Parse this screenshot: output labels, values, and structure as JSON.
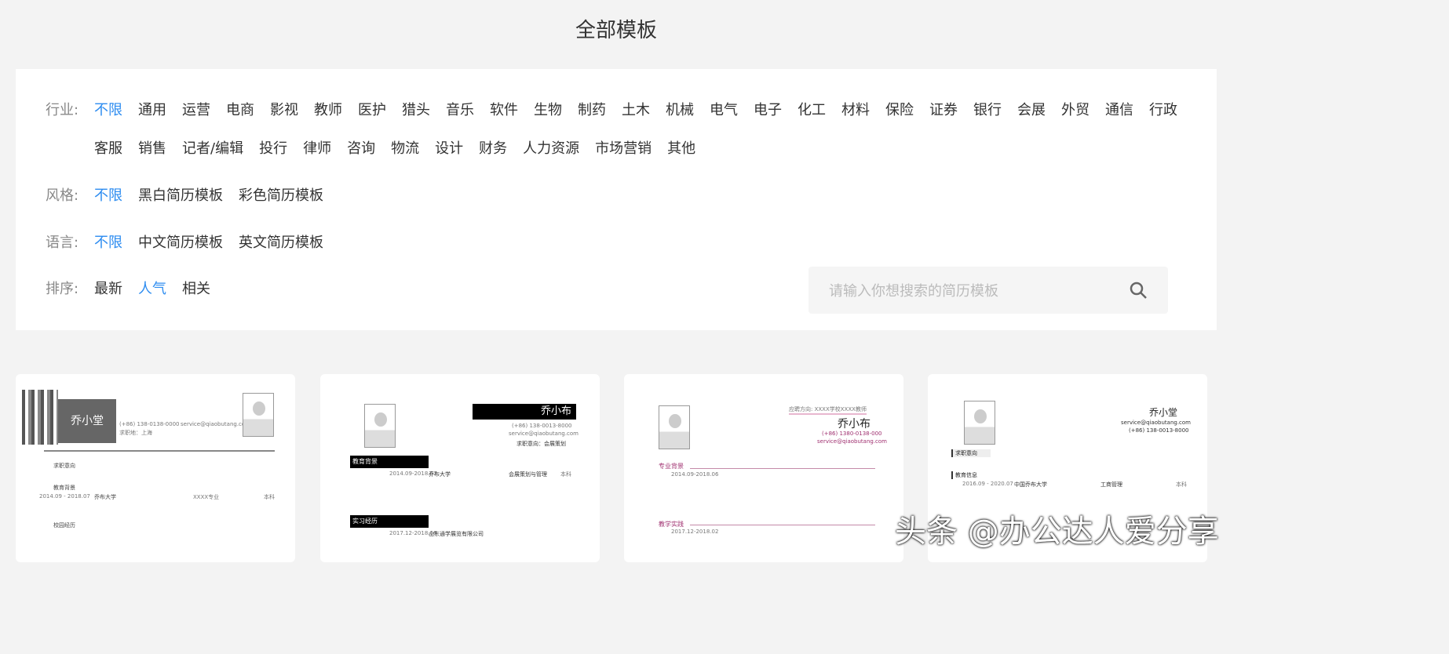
{
  "page_title": "全部模板",
  "filters": {
    "industry": {
      "label": "行业:",
      "options": [
        "不限",
        "通用",
        "运营",
        "电商",
        "影视",
        "教师",
        "医护",
        "猎头",
        "音乐",
        "软件",
        "生物",
        "制药",
        "土木",
        "机械",
        "电气",
        "电子",
        "化工",
        "材料",
        "保险",
        "证券",
        "银行",
        "会展",
        "外贸",
        "通信",
        "行政",
        "客服",
        "销售",
        "记者/编辑",
        "投行",
        "律师",
        "咨询",
        "物流",
        "设计",
        "财务",
        "人力资源",
        "市场营销",
        "其他"
      ],
      "active": "不限"
    },
    "style": {
      "label": "风格:",
      "options": [
        "不限",
        "黑白简历模板",
        "彩色简历模板"
      ],
      "active": "不限"
    },
    "language": {
      "label": "语言:",
      "options": [
        "不限",
        "中文简历模板",
        "英文简历模板"
      ],
      "active": "不限"
    },
    "sort": {
      "label": "排序:",
      "options": [
        "最新",
        "人气",
        "相关"
      ],
      "active": "人气"
    }
  },
  "search": {
    "placeholder": "请输入你想搜索的简历模板",
    "icon": "search-icon"
  },
  "templates": [
    {
      "name": "乔小堂",
      "phone": "(+86) 138-0138-0000",
      "email": "service@qiaobutang.com",
      "loc": "求职地：上海",
      "s1": "求职意向",
      "s2": "教育背景",
      "s3": "校园经历",
      "school": "乔布大学",
      "date": "2014.09 - 2018.07",
      "major": "XXXX专业",
      "degree": "本科"
    },
    {
      "name": "乔小布",
      "phone": "(+86) 138-0013-8000",
      "email": "service@qiaobutang.com",
      "intent": "求职意向：会展策划",
      "s1": "教育背景",
      "s2": "实习经历",
      "date": "2014.09-2018.07",
      "school": "乔布大学",
      "major": "会展策划与管理",
      "degree": "本科",
      "date2": "2017.12-2018.06",
      "company": "山东通学展览有限公司"
    },
    {
      "name": "乔小布",
      "target": "应聘方向:  XXXX学校XXXX教师",
      "phone": "(+86) 1380-0138-000",
      "email": "service@qiaobutang.com",
      "s1": "专业背景",
      "s2": "教学实践",
      "date": "2014.09-2018.06",
      "date2": "2017.12-2018.02"
    },
    {
      "name": "乔小堂",
      "email": "service@qiaobutang.com",
      "phone": "(+86) 138-0013-8000",
      "s1": "求职意向",
      "s2": "教育信息",
      "school": "中国乔布大学",
      "date": "2016.09 - 2020.07",
      "major": "工商管理",
      "degree": "本科"
    }
  ],
  "watermark": "头条 @办公达人爱分享"
}
